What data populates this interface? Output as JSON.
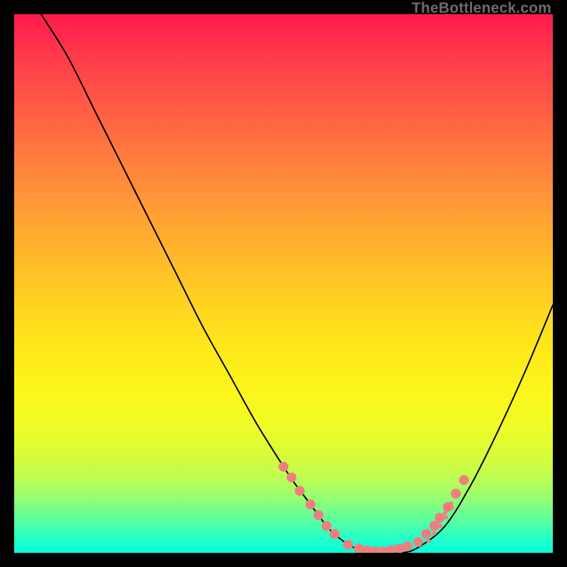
{
  "watermark": "TheBottleneck.com",
  "chart_data": {
    "type": "line",
    "title": "",
    "xlabel": "",
    "ylabel": "",
    "xlim": [
      0,
      100
    ],
    "ylim": [
      0,
      100
    ],
    "grid": false,
    "series": [
      {
        "name": "bottleneck-curve",
        "color": "#000000",
        "x": [
          5,
          10,
          15,
          20,
          25,
          30,
          35,
          40,
          45,
          50,
          52,
          55,
          58,
          60,
          63,
          66,
          69,
          72,
          75,
          80,
          85,
          90,
          95,
          100
        ],
        "y": [
          100,
          92,
          82,
          72,
          62,
          52,
          42,
          33,
          24,
          16,
          13,
          9,
          5,
          3,
          1,
          0,
          0,
          0,
          1,
          5,
          13,
          23,
          34,
          46
        ]
      }
    ],
    "markers": [
      {
        "name": "dots-left-branch",
        "color": "#ef7f7f",
        "radius_px": 7,
        "points": [
          {
            "x": 50,
            "y": 16
          },
          {
            "x": 51.5,
            "y": 14
          },
          {
            "x": 53,
            "y": 11.5
          },
          {
            "x": 55,
            "y": 9
          },
          {
            "x": 56.5,
            "y": 7
          },
          {
            "x": 58,
            "y": 5
          },
          {
            "x": 59.5,
            "y": 3.5
          }
        ]
      },
      {
        "name": "dots-bottom",
        "color": "#ef7f7f",
        "radius_px": 7,
        "points": [
          {
            "x": 62,
            "y": 1.5
          },
          {
            "x": 64,
            "y": 0.8
          },
          {
            "x": 65.5,
            "y": 0.5
          },
          {
            "x": 67,
            "y": 0.3
          },
          {
            "x": 68.5,
            "y": 0.3
          },
          {
            "x": 70,
            "y": 0.5
          },
          {
            "x": 71.5,
            "y": 0.8
          },
          {
            "x": 73,
            "y": 1.2
          }
        ]
      },
      {
        "name": "dots-right-branch",
        "color": "#ef7f7f",
        "radius_px": 7,
        "points": [
          {
            "x": 75,
            "y": 2
          },
          {
            "x": 76.5,
            "y": 3.5
          },
          {
            "x": 78,
            "y": 5
          },
          {
            "x": 79,
            "y": 6.5
          },
          {
            "x": 80.5,
            "y": 8.5
          },
          {
            "x": 82,
            "y": 11
          },
          {
            "x": 83.5,
            "y": 13.5
          }
        ]
      },
      {
        "name": "ticks-right",
        "color": "#ef7f7f",
        "radius_px": 3,
        "points": [
          {
            "x": 76.7,
            "y": 3.0
          },
          {
            "x": 76.9,
            "y": 2.2
          },
          {
            "x": 77.8,
            "y": 4.4
          },
          {
            "x": 78.0,
            "y": 3.6
          },
          {
            "x": 78.9,
            "y": 5.8
          },
          {
            "x": 79.1,
            "y": 5.0
          },
          {
            "x": 80.0,
            "y": 7.4
          },
          {
            "x": 80.2,
            "y": 6.6
          },
          {
            "x": 81.1,
            "y": 9.2
          },
          {
            "x": 81.3,
            "y": 8.4
          }
        ]
      }
    ]
  }
}
